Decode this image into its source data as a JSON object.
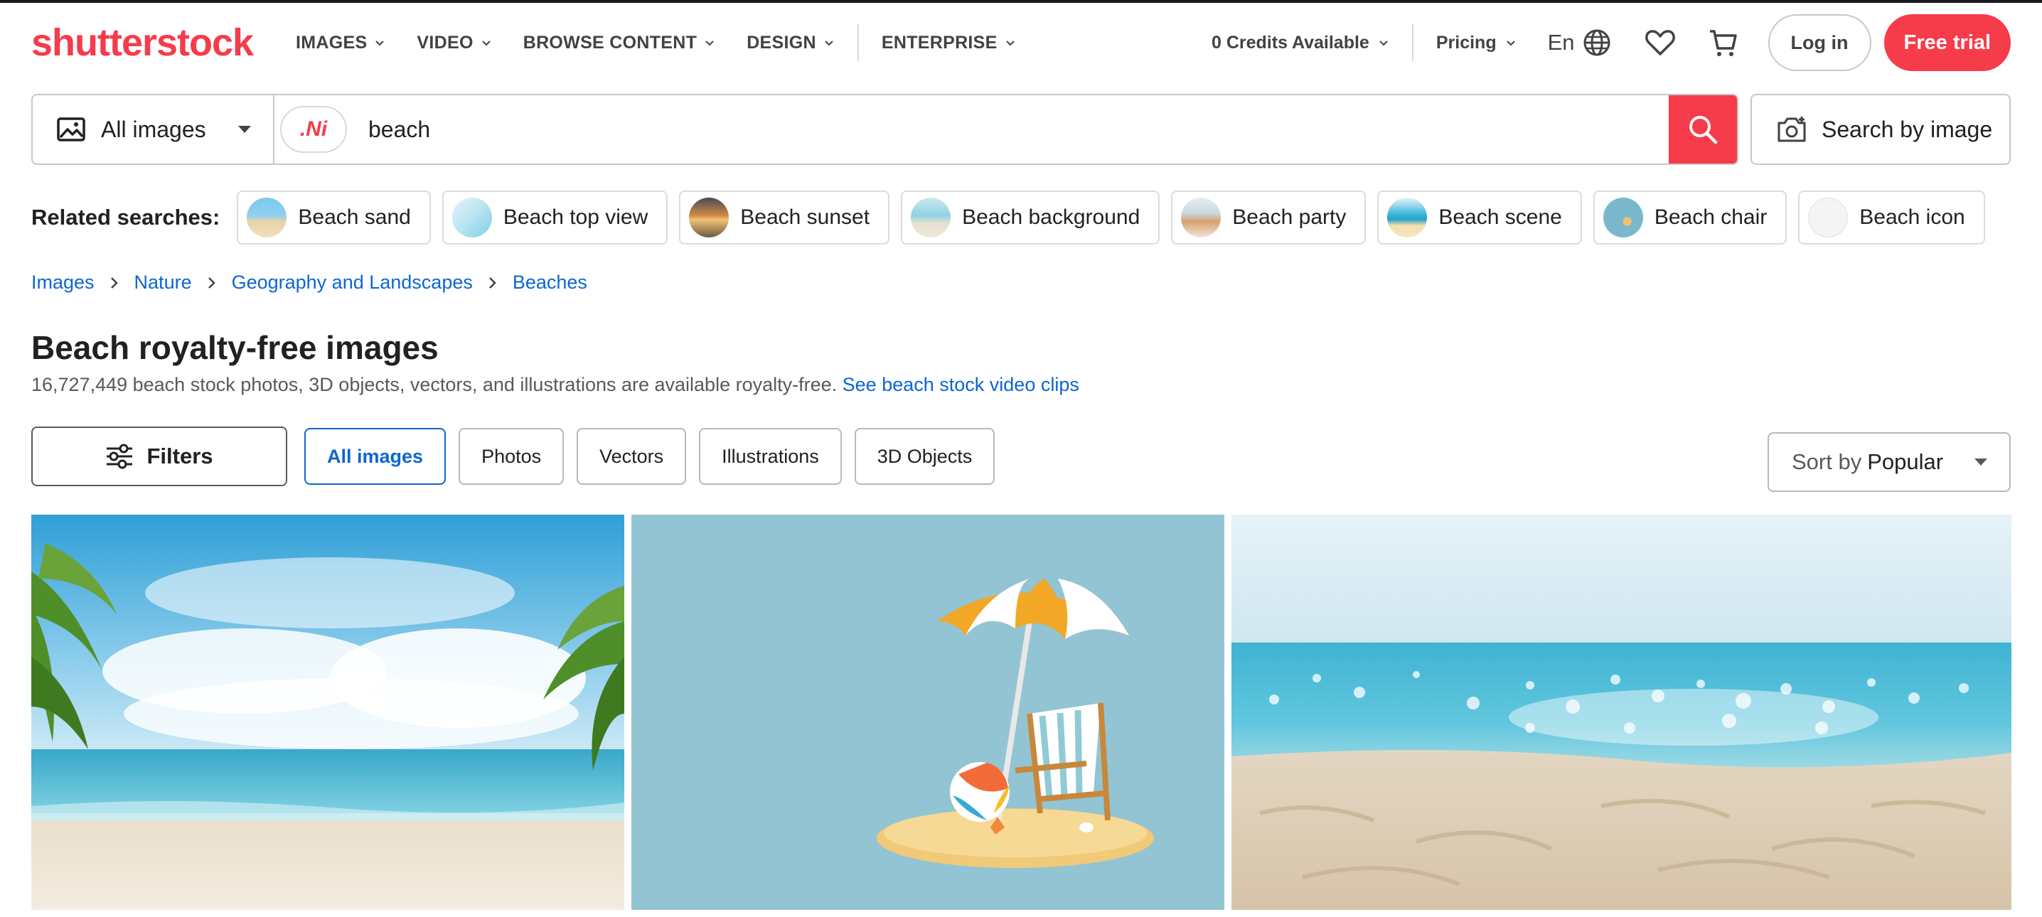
{
  "brand": {
    "logo": "shutterstock",
    "accent": "#f63b4a",
    "link": "#0d66d0"
  },
  "nav": {
    "items": [
      "IMAGES",
      "VIDEO",
      "BROWSE CONTENT",
      "DESIGN",
      "ENTERPRISE"
    ],
    "credits": "0 Credits Available",
    "pricing": "Pricing",
    "lang": "En",
    "login": "Log in",
    "trial": "Free trial"
  },
  "search": {
    "type": "All images",
    "ai_chip": ".Ni",
    "query": "beach",
    "search_by_image": "Search by image"
  },
  "related": {
    "label": "Related searches:",
    "items": [
      "Beach sand",
      "Beach top view",
      "Beach sunset",
      "Beach background",
      "Beach party",
      "Beach scene",
      "Beach chair",
      "Beach icon"
    ]
  },
  "breadcrumb": [
    "Images",
    "Nature",
    "Geography and Landscapes",
    "Beaches"
  ],
  "page": {
    "title": "Beach royalty-free images",
    "subtitle": "16,727,449 beach stock photos, 3D objects, vectors, and illustrations are available royalty-free.",
    "video_link": "See beach stock video clips"
  },
  "filters": {
    "label": "Filters",
    "tabs": [
      "All images",
      "Photos",
      "Vectors",
      "Illustrations",
      "3D Objects"
    ],
    "active_tab": "All images",
    "sort_prefix": "Sort by",
    "sort_value": "Popular"
  },
  "results": [
    {
      "subject": "tropical beach with palm leaves and sea"
    },
    {
      "subject": "3d beach umbrella, deck chair and ball on sand island"
    },
    {
      "subject": "blurred sparkling sea over sandy beach"
    }
  ]
}
